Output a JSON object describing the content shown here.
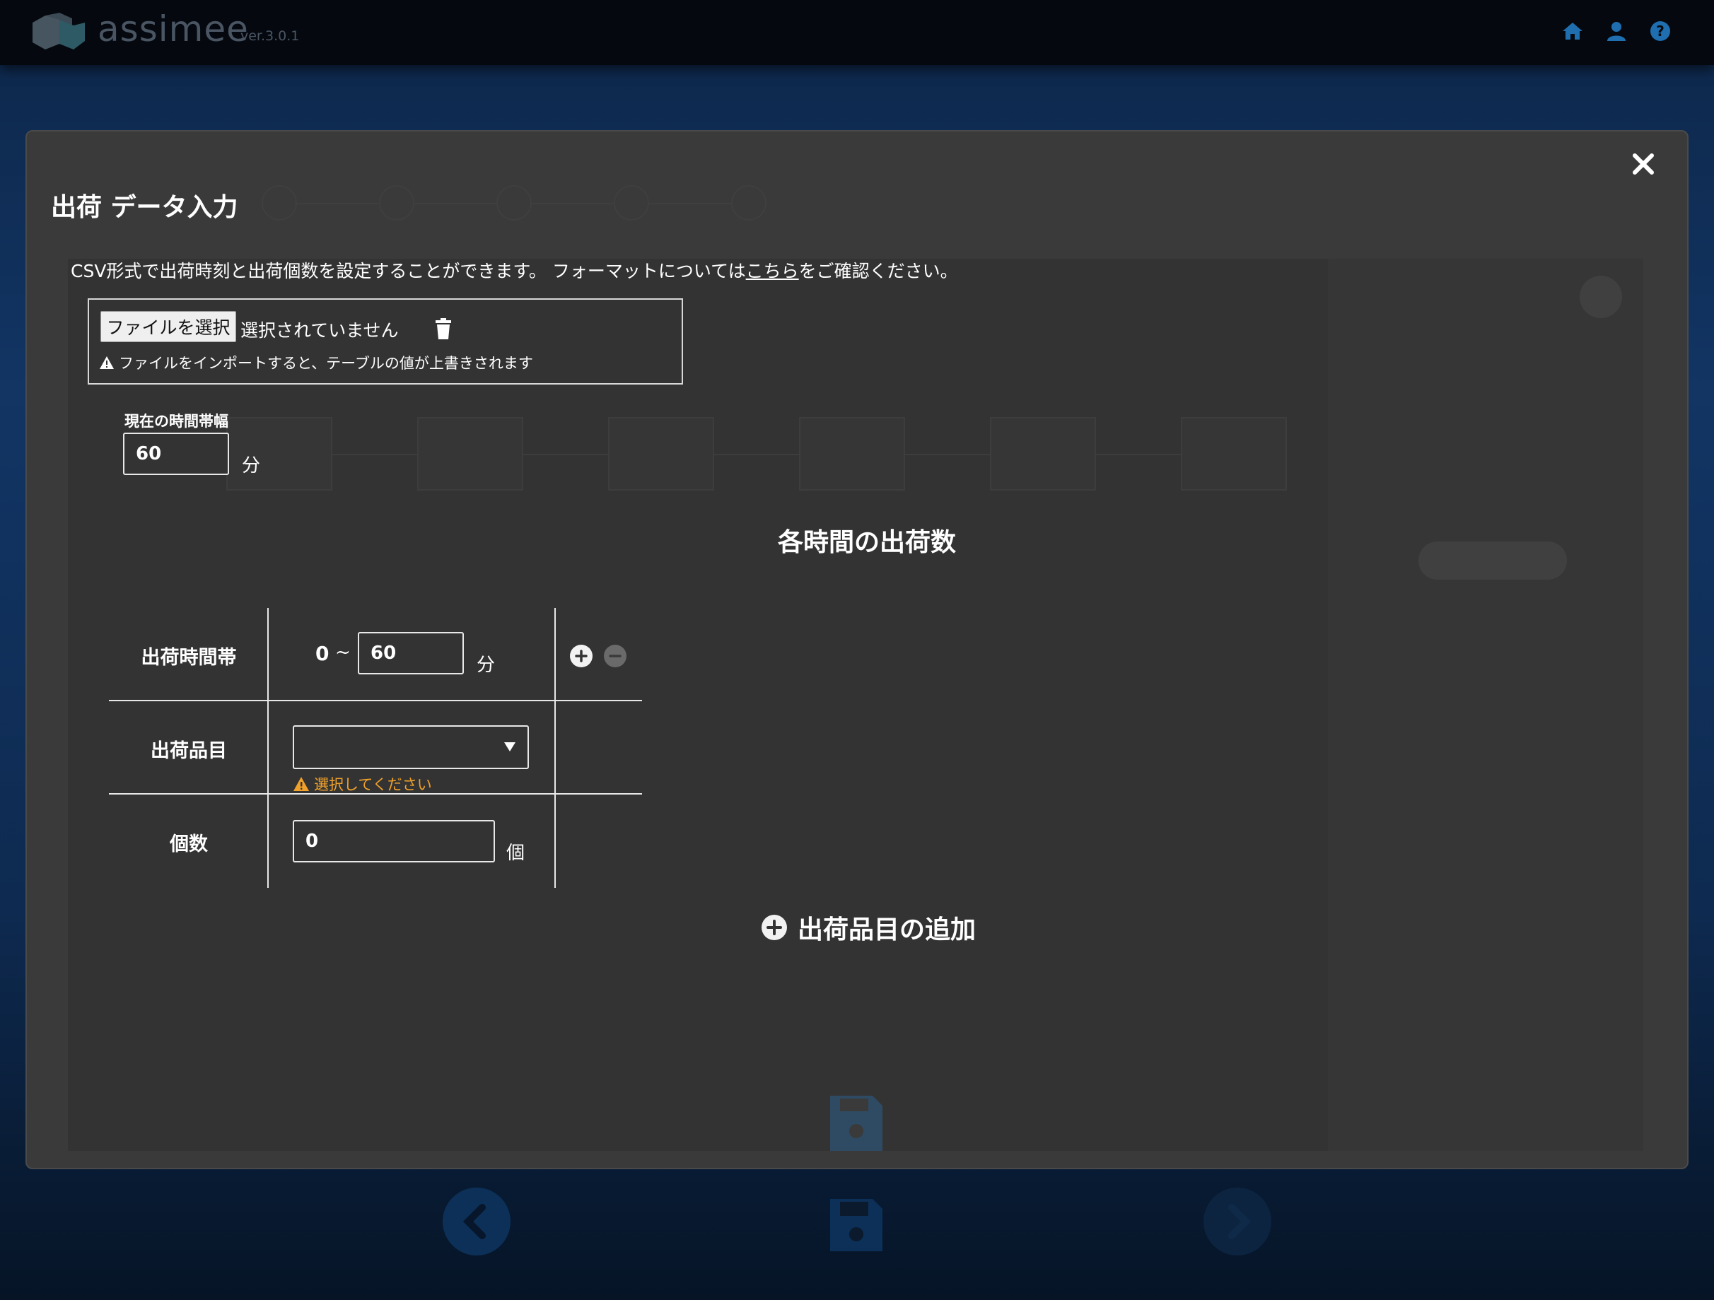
{
  "app": {
    "brand": "assimee",
    "version": "ver.3.0.1"
  },
  "modal": {
    "title": "出荷 データ入力",
    "csv": {
      "text_before": "CSV形式で出荷時刻と出荷個数を設定することができます。 フォーマットについては",
      "link": "こちら",
      "text_after": "をご確認ください。"
    },
    "file": {
      "button": "ファイルを選択",
      "none": "選択されていません",
      "warning": "ファイルをインポートすると、テーブルの値が上書きされます"
    },
    "time_width": {
      "label": "現在の時間帯幅",
      "value": "60",
      "unit": "分"
    },
    "section_title": "各時間の出荷数",
    "table": {
      "time_band": {
        "label": "出荷時間帯",
        "from": "0",
        "tilde": "~",
        "to": "60",
        "unit": "分"
      },
      "item": {
        "label": "出荷品目",
        "value": "",
        "warning": "選択してください"
      },
      "count": {
        "label": "個数",
        "value": "0",
        "unit": "個"
      }
    },
    "add_item": "出荷品目の追加"
  },
  "colors": {
    "modal_bg": "#3a3a3a",
    "inner_bg": "#333333",
    "warning": "#f0a12a",
    "topbar": "#05090f"
  }
}
